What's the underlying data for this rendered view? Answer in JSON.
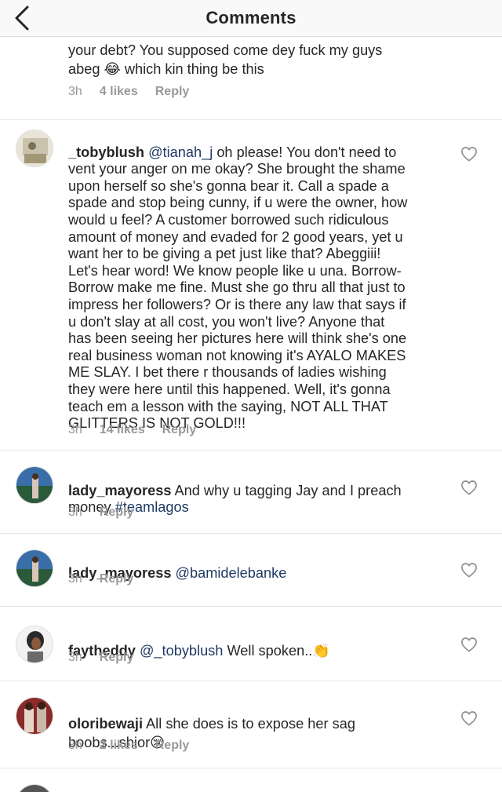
{
  "header": {
    "title": "Comments",
    "back_icon": "chevron-left-icon"
  },
  "comments": [
    {
      "text": "your debt? You supposed come dey fuck my guys\nabeg 😂 which kin thing be this",
      "time": "3h",
      "likes": "4 likes",
      "reply": "Reply"
    },
    {
      "username": "_tobyblush",
      "mention": "@tianah_j",
      "text": " oh please! You don't need to\nvent your anger on me okay? She brought the shame\nupon herself so she's gonna bear it. Call a spade a\nspade and stop being cunny, if u were the owner, how\nwould u feel? A customer borrowed such ridiculous\namount of money and evaded for 2 good years, yet u\nwant her to be giving a pet just like that? Abeggiii!\nLet's hear word! We know people like u una. Borrow-\nBorrow make me fine. Must she go thru all that just to\nimpress her followers? Or is there any law that says if\nu don't slay at all cost, you won't live?  Anyone that\nhas been seeing her pictures here will think she's one\nreal business woman not knowing it's AYALO MAKES\nME SLAY. I bet there r thousands of ladies wishing\nthey were here until this happened. Well, it's gonna\nteach em a lesson with the saying, NOT ALL THAT\nGLITTERS IS NOT GOLD!!!",
      "time": "3h",
      "likes": "14 likes",
      "reply": "Reply"
    },
    {
      "username": "lady_mayoress",
      "text": " And why u tagging Jay and I preach\nmoney ",
      "hashtag": "#teamlagos",
      "time": "3h",
      "reply": "Reply"
    },
    {
      "username": "lady_mayoress",
      "mention": "@bamidelebanke",
      "time": "3h",
      "reply": "Reply"
    },
    {
      "username": "faytheddy",
      "mention": "@_tobyblush",
      "text": " Well spoken..👏",
      "time": "3h",
      "reply": "Reply"
    },
    {
      "username": "oloribewaji",
      "text": " All she does is to expose her sag\nboobs...shior😢",
      "time": "3h",
      "likes": "2 likes",
      "reply": "Reply"
    }
  ],
  "colors": {
    "text": "#262626",
    "meta": "#999999",
    "mention": "#1f3a63",
    "divider": "#e6e6e6"
  }
}
